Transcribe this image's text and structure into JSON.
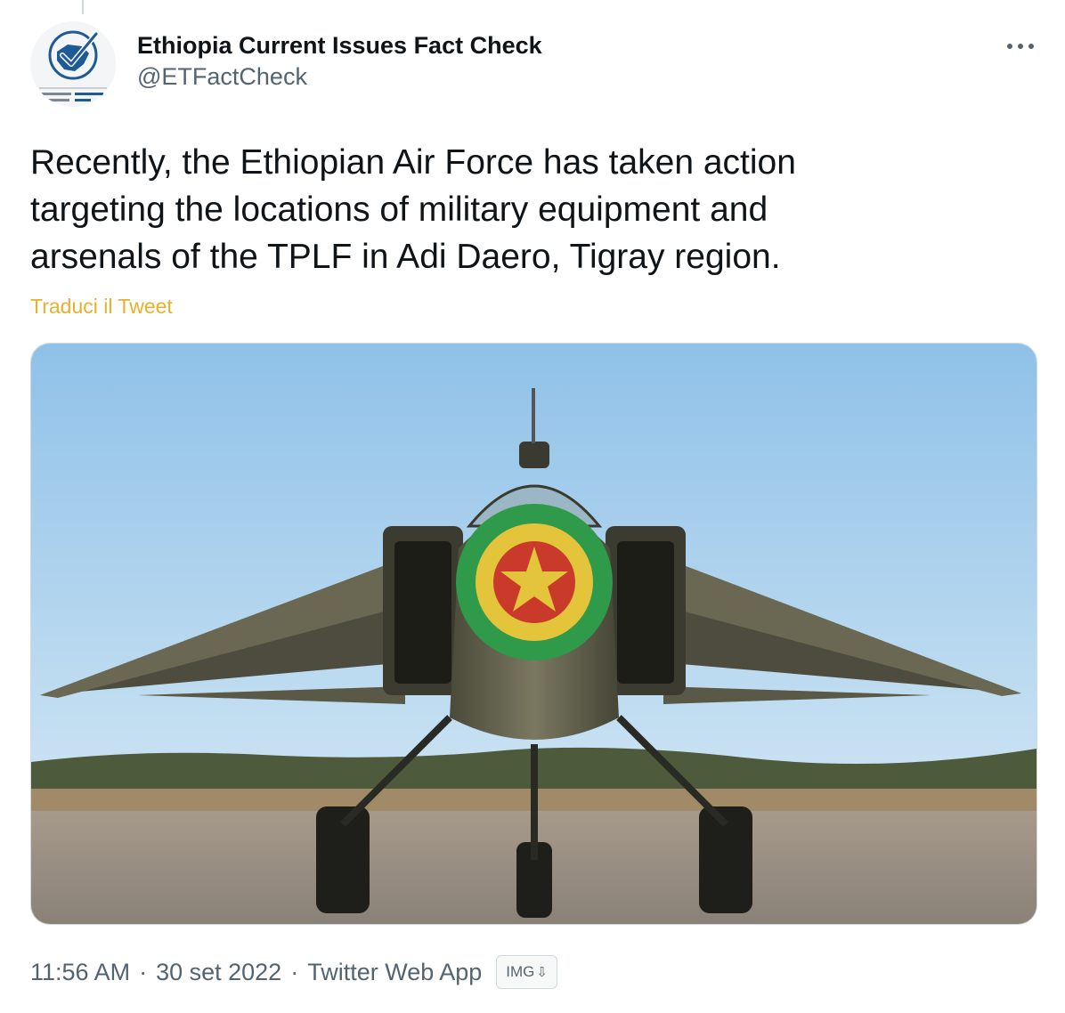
{
  "tweet": {
    "author": {
      "display_name": "Ethiopia Current Issues Fact Check",
      "handle": "@ETFactCheck",
      "avatar_text": "Ethiopia Current Issues Fact Check"
    },
    "text": "Recently, the Ethiopian Air Force has taken action\ntargeting the locations of military equipment and\narsenals of the TPLF in Adi Daero, Tigray region.",
    "translate_label": "Traduci il Tweet",
    "time": "11:56 AM",
    "date": "30 set 2022",
    "source": "Twitter Web App",
    "separator": "·",
    "img_badge": "IMG",
    "img_badge_arrow": "⇩"
  },
  "icons": {
    "more": "more-horizontal-icon",
    "avatar_logo": "fact-check-logo",
    "roundel": "ethiopian-air-force-roundel"
  },
  "colors": {
    "text_primary": "#0f1419",
    "text_secondary": "#536471",
    "translate_link": "#e8b02c",
    "border": "#cfd9de",
    "avatar_blue": "#1e5a96"
  }
}
